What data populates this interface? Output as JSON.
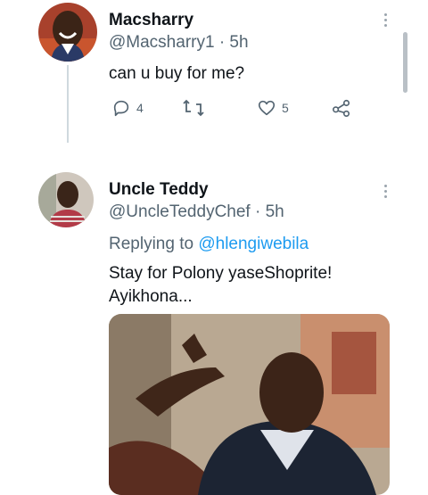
{
  "tweets": [
    {
      "name": "Macsharry",
      "handle": "@Macsharry1 · 5h",
      "text": "can u buy for me?",
      "actions": {
        "reply_count": "4",
        "retweet_count": "",
        "like_count": "5"
      }
    },
    {
      "name": "Uncle Teddy",
      "handle": "@UncleTeddyChef · 5h",
      "replying_label": "Replying to",
      "replying_to": "@hlengiwebila",
      "text_line1": "Stay for Polony yaseShoprite!",
      "text_line2": "Ayikhona..."
    }
  ],
  "colors": {
    "accent": "#1d9bf0",
    "muted": "#536471",
    "text": "#0f1419"
  }
}
